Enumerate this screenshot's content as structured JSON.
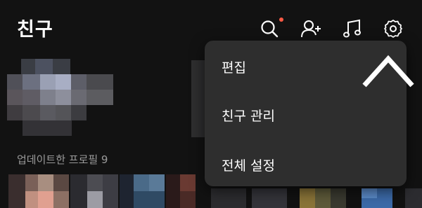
{
  "header": {
    "title": "친구",
    "icons": [
      "search-icon",
      "add-friend-icon",
      "music-icon",
      "settings-icon"
    ],
    "notification_color": "#ff5a45"
  },
  "section": {
    "updated_profiles_label": "업데이트한 프로필 9"
  },
  "menu": {
    "items": [
      {
        "label": "편집"
      },
      {
        "label": "친구 관리"
      },
      {
        "label": "전체 설정"
      }
    ]
  }
}
